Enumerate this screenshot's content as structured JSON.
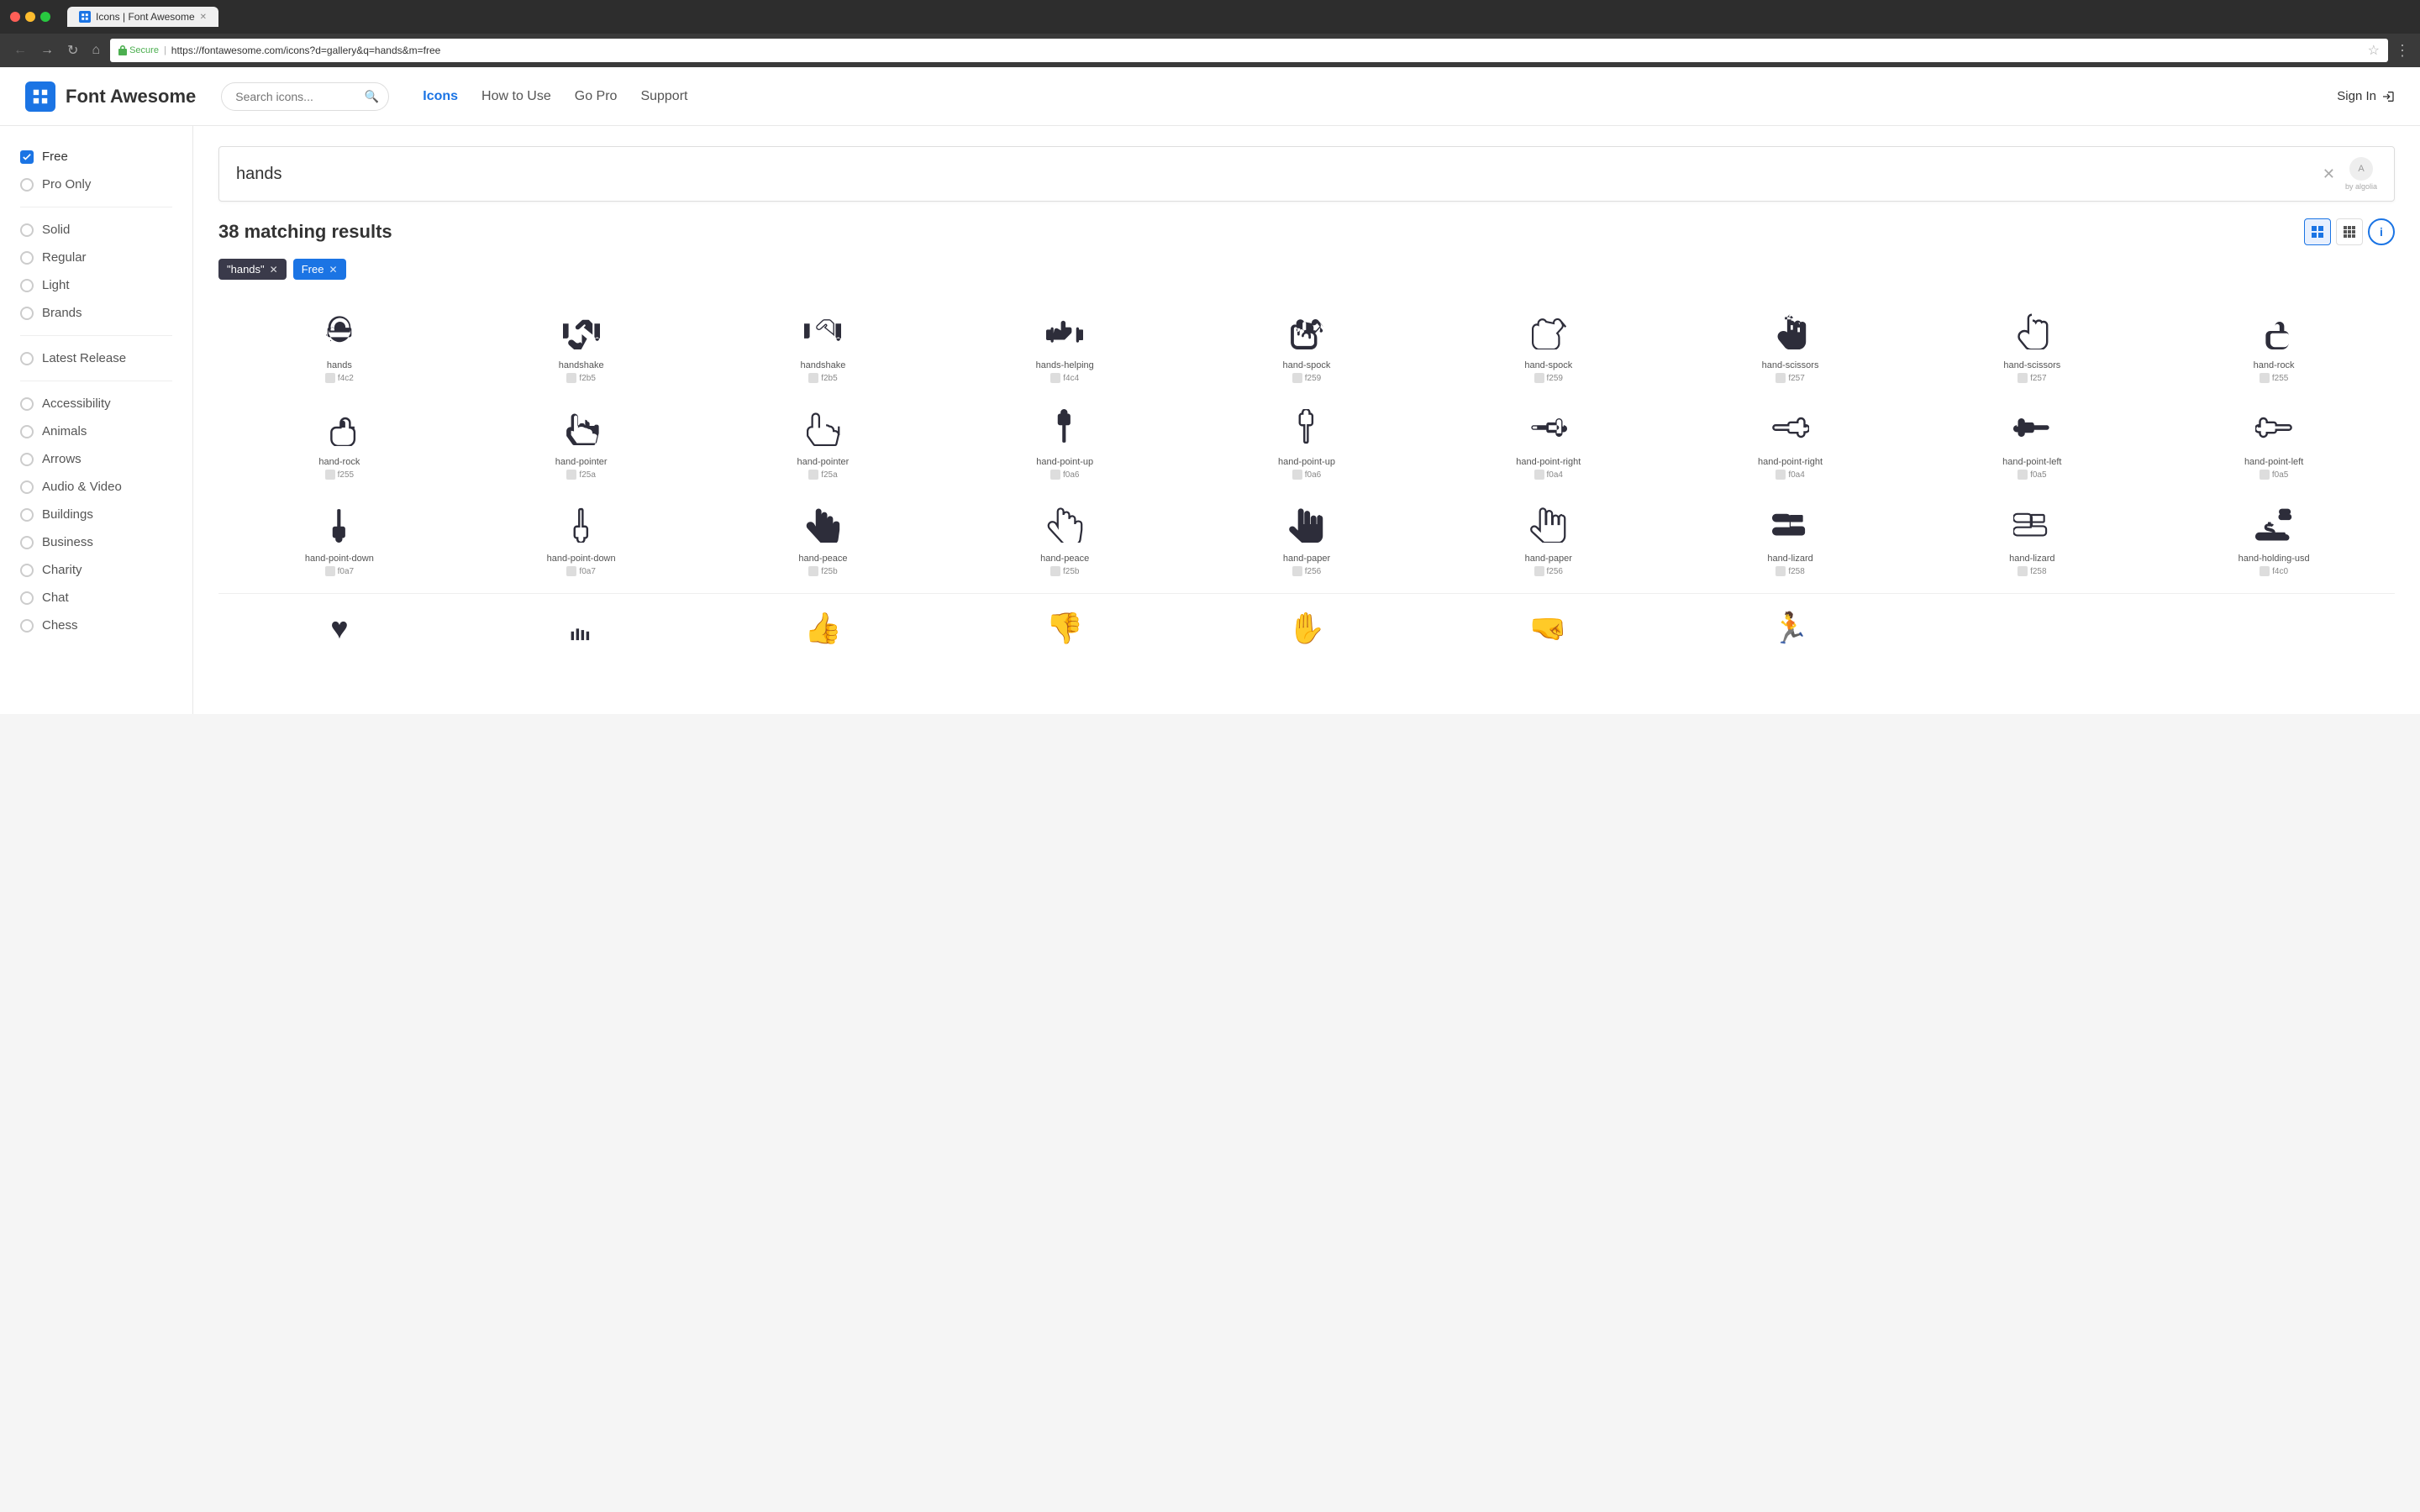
{
  "browser": {
    "tab_title": "Icons | Font Awesome",
    "url": "https://fontawesome.com/icons?d=gallery&q=hands&m=free",
    "secure_label": "Secure",
    "nav_back": "←",
    "nav_forward": "→",
    "nav_refresh": "↻",
    "nav_home": "⌂"
  },
  "header": {
    "logo_text": "Font Awesome",
    "search_placeholder": "Search icons...",
    "nav_items": [
      "Icons",
      "How to Use",
      "Go Pro",
      "Support"
    ],
    "nav_active": "Icons",
    "sign_in": "Sign In"
  },
  "sidebar": {
    "filter_free": "Free",
    "filter_pro": "Pro Only",
    "styles": [
      "Solid",
      "Regular",
      "Light",
      "Brands"
    ],
    "latest_release": "Latest Release",
    "categories": [
      "Accessibility",
      "Animals",
      "Arrows",
      "Audio & Video",
      "Buildings",
      "Business",
      "Charity",
      "Chat",
      "Chess"
    ]
  },
  "search": {
    "query": "hands",
    "clear_btn": "✕",
    "algolia_label": "by algolia"
  },
  "results": {
    "count": "38 matching results",
    "filters": [
      {
        "label": "\"hands\"",
        "type": "query"
      },
      {
        "label": "Free",
        "type": "free"
      }
    ]
  },
  "icons": [
    {
      "name": "hands",
      "code": "f4c2",
      "glyph": "🤲"
    },
    {
      "name": "handshake",
      "code": "f2b5",
      "glyph": "🤝"
    },
    {
      "name": "handshake",
      "code": "f2b5",
      "glyph": "🤝"
    },
    {
      "name": "hands-helping",
      "code": "f4c4",
      "glyph": "🙌"
    },
    {
      "name": "hand-spock",
      "code": "f259",
      "glyph": "🖖"
    },
    {
      "name": "hand-spock",
      "code": "f259",
      "glyph": "🖖"
    },
    {
      "name": "hand-scissors",
      "code": "f257",
      "glyph": "✌️"
    },
    {
      "name": "hand-scissors",
      "code": "f257",
      "glyph": "✌️"
    },
    {
      "name": "hand-rock",
      "code": "f255",
      "glyph": "✊"
    },
    {
      "name": "hand-rock",
      "code": "f255",
      "glyph": "✊"
    },
    {
      "name": "hand-pointer",
      "code": "f25a",
      "glyph": "👇"
    },
    {
      "name": "hand-pointer",
      "code": "f25a",
      "glyph": "👇"
    },
    {
      "name": "hand-point-up",
      "code": "f0a6",
      "glyph": "☝️"
    },
    {
      "name": "hand-point-up",
      "code": "f0a6",
      "glyph": "☝️"
    },
    {
      "name": "hand-point-right",
      "code": "f0a4",
      "glyph": "👉"
    },
    {
      "name": "hand-point-right",
      "code": "f0a4",
      "glyph": "👉"
    },
    {
      "name": "hand-point-left",
      "code": "f0a5",
      "glyph": "👈"
    },
    {
      "name": "hand-point-left",
      "code": "f0a5",
      "glyph": "👈"
    },
    {
      "name": "hand-point-down",
      "code": "f0a7",
      "glyph": "👇"
    },
    {
      "name": "hand-point-down",
      "code": "f0a7",
      "glyph": "👇"
    },
    {
      "name": "hand-peace",
      "code": "f25b",
      "glyph": "✌️"
    },
    {
      "name": "hand-peace",
      "code": "f25b",
      "glyph": "✌️"
    },
    {
      "name": "hand-paper",
      "code": "f256",
      "glyph": "✋"
    },
    {
      "name": "hand-paper",
      "code": "f256",
      "glyph": "✋"
    },
    {
      "name": "hand-lizard",
      "code": "f258",
      "glyph": "🤙"
    },
    {
      "name": "hand-lizard",
      "code": "f258",
      "glyph": "🤙"
    },
    {
      "name": "hand-holding-usd",
      "code": "f4c0",
      "glyph": "💵"
    }
  ],
  "colors": {
    "accent": "#1b74e4",
    "icon_dark": "#2d2d3a"
  }
}
